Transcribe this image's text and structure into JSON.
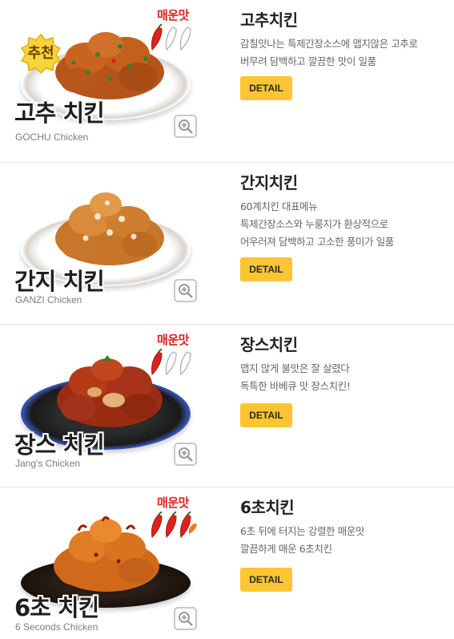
{
  "items": [
    {
      "title": "고추치킨",
      "overlay_name": "고추 치킨",
      "sub_name": "GOCHU Chicken",
      "desc": [
        "감칠맛나는 특제간장소스에 맵지않은 고추로",
        "버무려 담백하고 깔끔한 맛이 일품"
      ],
      "detail_label": "DETAIL",
      "badge": "추천",
      "spicy_label": "매운맛",
      "spicy_level": 1,
      "plate": "white"
    },
    {
      "title": "간지치킨",
      "overlay_name": "간지 치킨",
      "sub_name": "GANZI Chicken",
      "desc": [
        "60계치킨 대표메뉴",
        "특제간장소스와 누룽지가 환상적으로",
        "어우러져 담백하고 고소한 풍미가 일품"
      ],
      "detail_label": "DETAIL",
      "plate": "white"
    },
    {
      "title": "장스치킨",
      "overlay_name": "장스 치킨",
      "sub_name": "Jang's Chicken",
      "desc": [
        "맵지 않게 불맛은 잘 살렸다",
        "독특한 바베큐 맛 장스치킨!"
      ],
      "detail_label": "DETAIL",
      "spicy_label": "매운맛",
      "spicy_level": 1,
      "plate": "dark"
    },
    {
      "title": "6초치킨",
      "overlay_name": "6초 치킨",
      "sub_name": "6 Seconds Chicken",
      "desc": [
        "6초 뒤에 터지는 강렬한 매운맛",
        "깔끔하게 매운 6초치킨"
      ],
      "detail_label": "DETAIL",
      "spicy_label": "매운맛",
      "spicy_level": 3,
      "plate": "black"
    }
  ],
  "colors": {
    "button": "#fdc533",
    "spicy_text": "#e02020",
    "pepper_red": "#d9241c",
    "pepper_outline": "#b5b5b5",
    "badge": "#f7d43b"
  },
  "icons": {
    "zoom": "magnifier-plus-icon",
    "pepper": "chili-pepper-icon",
    "badge": "star-badge-icon"
  }
}
